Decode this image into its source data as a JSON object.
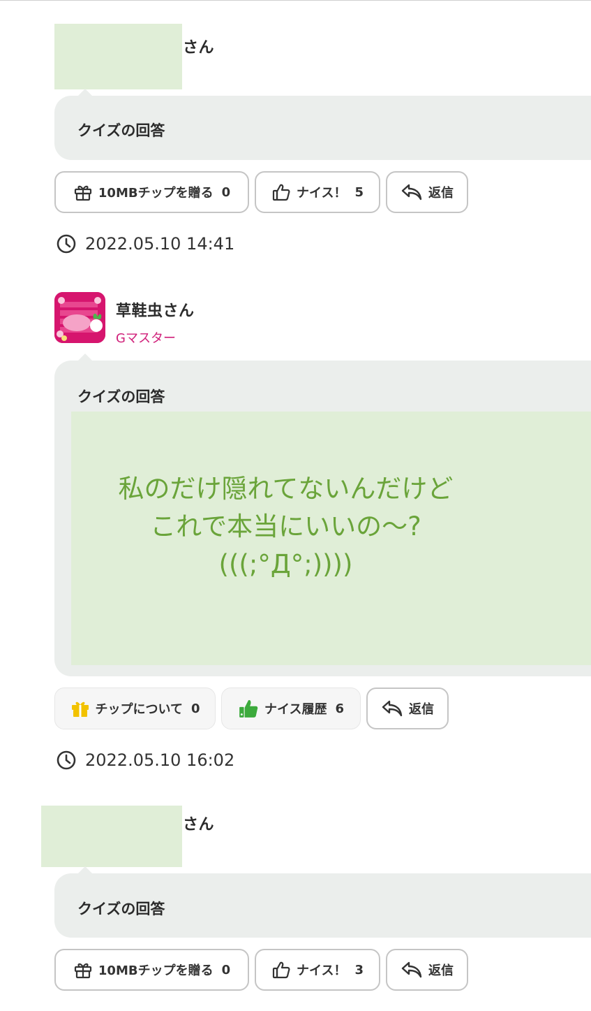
{
  "posts": [
    {
      "author_suffix": "さん",
      "title": "クイズの回答",
      "buttons": {
        "tip_label": "10MBチップを贈る",
        "tip_count": "0",
        "nice_label": "ナイス！",
        "nice_count": "5",
        "reply_label": "返信"
      },
      "timestamp": "2022.05.10 14:41"
    },
    {
      "author": "草鞋虫さん",
      "rank": "Gマスター",
      "title": "クイズの回答",
      "quote_lines": [
        "私のだけ隠れてないんだけど",
        "これで本当にいいの〜?",
        "(((;°Д°;))))"
      ],
      "buttons": {
        "tip_label": "チップについて",
        "tip_count": "0",
        "nice_label": "ナイス履歴",
        "nice_count": "6",
        "reply_label": "返信"
      },
      "timestamp": "2022.05.10 16:02"
    },
    {
      "author_suffix": "さん",
      "title": "クイズの回答",
      "buttons": {
        "tip_label": "10MBチップを贈る",
        "tip_count": "0",
        "nice_label": "ナイス！",
        "nice_count": "3",
        "reply_label": "返信"
      }
    }
  ],
  "colors": {
    "bubble": "#ebeeec",
    "mask_green": "#e0eed7",
    "quote_text": "#6aa43a",
    "rank": "#d0207a",
    "gift_yellow": "#f2c200",
    "thumb_green": "#3caa3c"
  },
  "icons": [
    "gift-icon",
    "thumbs-up-icon",
    "reply-icon",
    "clock-icon",
    "avatar"
  ]
}
